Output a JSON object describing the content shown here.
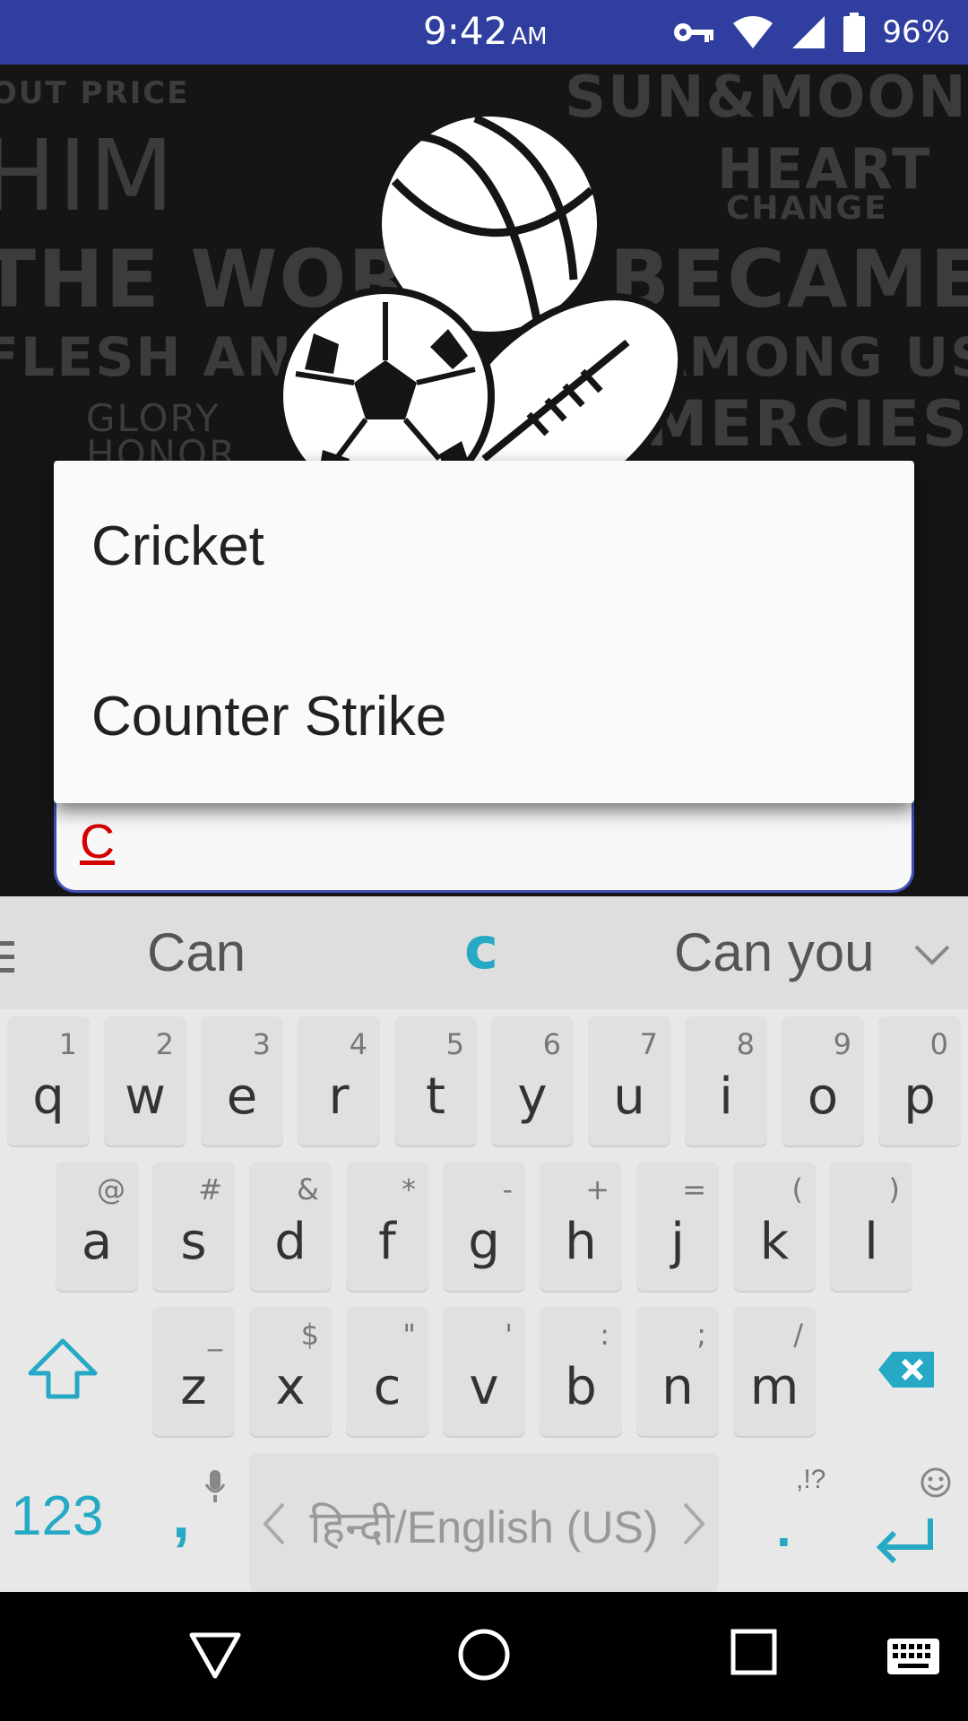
{
  "status_bar": {
    "time": "9:42",
    "ampm": "AM",
    "battery_percent": "96%",
    "icons": [
      "key-icon",
      "wifi-icon",
      "signal-icon",
      "battery-icon"
    ]
  },
  "background": {
    "words": [
      "OUT PRICE",
      "HIM",
      "SUN&MOON",
      "HEART",
      "CHANGE",
      "THE WORD",
      "BECAME",
      "FLESH AND",
      "AMONG US",
      "MERCIES",
      "GLORY",
      "HONOR"
    ]
  },
  "dropdown": {
    "items": [
      "Cricket",
      "Counter Strike"
    ]
  },
  "search_field": {
    "value": "C"
  },
  "keyboard": {
    "suggestions": [
      "Can",
      "c",
      "Can you"
    ],
    "rows": [
      [
        [
          "q",
          "1"
        ],
        [
          "w",
          "2"
        ],
        [
          "e",
          "3"
        ],
        [
          "r",
          "4"
        ],
        [
          "t",
          "5"
        ],
        [
          "y",
          "6"
        ],
        [
          "u",
          "7"
        ],
        [
          "i",
          "8"
        ],
        [
          "o",
          "9"
        ],
        [
          "p",
          "0"
        ]
      ],
      [
        [
          "a",
          "@"
        ],
        [
          "s",
          "#"
        ],
        [
          "d",
          "&"
        ],
        [
          "f",
          "*"
        ],
        [
          "g",
          "-"
        ],
        [
          "h",
          "+"
        ],
        [
          "j",
          "="
        ],
        [
          "k",
          "("
        ],
        [
          "l",
          ")"
        ]
      ],
      [
        [
          "z",
          "_"
        ],
        [
          "x",
          "$"
        ],
        [
          "c",
          "\""
        ],
        [
          "v",
          "'"
        ],
        [
          "b",
          ":"
        ],
        [
          "n",
          ";"
        ],
        [
          "m",
          "/"
        ]
      ]
    ],
    "symbols_label": "123",
    "comma": ",",
    "period": ".",
    "period_hint": ",!?",
    "space_label": "हिन्दी/English (US)",
    "accent": "#26a9c4"
  },
  "nav_bar": {
    "icons": [
      "back-icon",
      "home-icon",
      "recents-icon",
      "keyboard-switch-icon"
    ]
  }
}
